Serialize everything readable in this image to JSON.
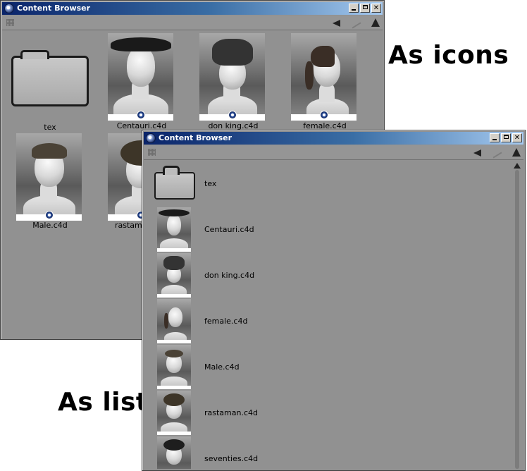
{
  "captions": {
    "icons": "As icons",
    "list": "As list"
  },
  "window": {
    "title": "Content Browser",
    "controls": {
      "minimize": "_",
      "maximize": "□",
      "close": "✕"
    }
  },
  "icon_view": {
    "items": [
      {
        "label": "tex",
        "kind": "folder"
      },
      {
        "label": "Centauri.c4d",
        "kind": "mohawk"
      },
      {
        "label": "don king.c4d",
        "kind": "tall"
      },
      {
        "label": "female.c4d",
        "kind": "ponytail"
      },
      {
        "label": "Male.c4d",
        "kind": "short"
      },
      {
        "label": "rastaman.c4d",
        "kind": "rasta"
      }
    ]
  },
  "list_view": {
    "items": [
      {
        "label": "tex",
        "kind": "folder"
      },
      {
        "label": "Centauri.c4d",
        "kind": "mohawk"
      },
      {
        "label": "don king.c4d",
        "kind": "tall"
      },
      {
        "label": "female.c4d",
        "kind": "ponytail"
      },
      {
        "label": "Male.c4d",
        "kind": "short"
      },
      {
        "label": "rastaman.c4d",
        "kind": "rasta"
      },
      {
        "label": "seventies.c4d",
        "kind": "seventies"
      }
    ]
  },
  "colors": {
    "window_bg": "#919191",
    "title_gradient_start": "#0a246a",
    "title_gradient_end": "#a6caf0"
  }
}
